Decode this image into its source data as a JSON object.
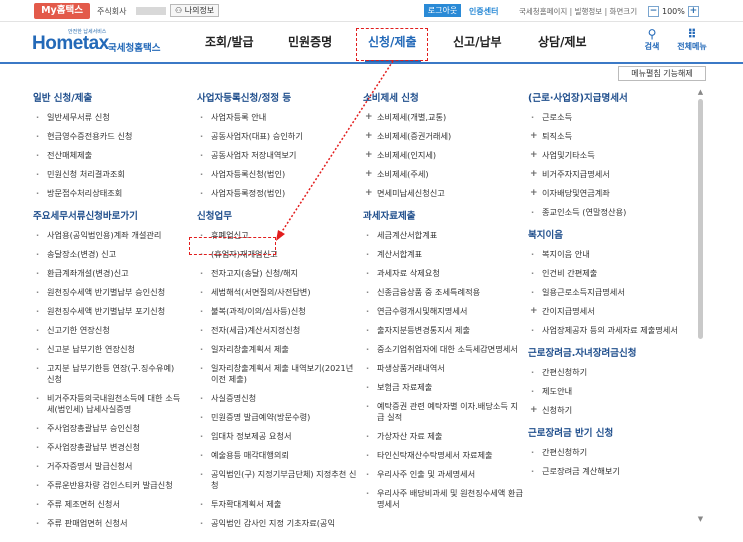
{
  "topbar": {
    "my_tab": "My홈택스",
    "company_label": "주식회사",
    "myinfo_label": "나의정보",
    "logout_label": "로그아웃",
    "cert_center_label": "인증센터",
    "links_text": "국세청홈페이지 | 빌행정보 | 화면크기",
    "zoom_minus": "−",
    "zoom_level": "100%",
    "zoom_plus": "+"
  },
  "header": {
    "logo_small": "안전한 납세서비스",
    "logo_main": "Hometax",
    "logo_sub": "국세청홈택스",
    "nav": [
      "조회/발급",
      "민원증명",
      "신청/제출",
      "신고/납부",
      "상담/제보"
    ],
    "active_nav": "신청/제출",
    "search_label": "검색",
    "allmenu_label": "전체메뉴",
    "search_icon": "search-icon",
    "allmenu_icon": "grid-icon"
  },
  "menu_toggle_label": "메뉴펼침 기능해제",
  "col1": {
    "title": "일반 신청/제출",
    "items": [
      "일반세무서류 신청",
      "현금영수증전용카드 신청",
      "전산매체제출",
      "민원신청 처리결과조회",
      "방문접수처리상태조회"
    ],
    "title2": "주요세무서류신청바로가기",
    "items2": [
      "사업용(공익법인용)계좌 개설관리",
      "송달장소(변경) 신고",
      "환급계좌개설(변경)신고",
      "원천징수세액 반기별납부 승인신청",
      "원천징수세액 반기별납부 포기신청",
      "신고기한 연장신청",
      "신고분 납부기한 연장신청",
      "고지분 납부기한등 연장(구.징수유예) 신청",
      "비거주자등의국내원천소득에 대한 소득세(법인세) 납세사실증명",
      "주사업장총괄납부 승인신청",
      "주사업장총괄납부 변경신청",
      "거주자증명서 발급신청서",
      "주류운반용차량 검인스티커 발급신청",
      "주류 제조면허 신청서",
      "주류 판매업면허 신청서"
    ]
  },
  "col2": {
    "title": "사업자등록신청/정정 등",
    "items": [
      "사업자등록 안내",
      "공동사업자(대표) 승인하기",
      "공동사업자 저장내역보기",
      "사업자등록신청(법인)",
      "사업자등록정정(법인)"
    ],
    "title2": "신청업무",
    "items2": [
      "휴폐업신고",
      "(휴업자)재개업신고",
      "전자고지(송달) 신청/해지",
      "세법해석(서면질의/사전답변)",
      "불복(과적/이의/심사등)신청",
      "전자(세금)계산서지정신청",
      "일자리창출계획서 제출",
      "일자리창출계획서 제출 내역보기(2021년 이전 제출)",
      "사실증명신청",
      "민원증명 발급예약(방문수령)",
      "임대차 정보제공 요청서",
      "예술용등 매각대행의뢰",
      "공익법인(구) 지정기부금단체) 지정추천 신청",
      "투자확대계획서 제출",
      "공익법인 감사인 지정 기초자료(공익"
    ]
  },
  "col3": {
    "title": "소비제세 신청",
    "items": [
      "소비제세(개별,교통)",
      "소비제세(증권거래세)",
      "소비제세(인지세)",
      "소비제세(주세)",
      "면세미납세신청신고"
    ],
    "title2": "과세자료제출",
    "items2": [
      "세금계산서합계표",
      "계산서합계표",
      "과세자료 삭제요청",
      "신종금융상품 중 조세특례적용",
      "연금수령개시및해지명세서",
      "출자지분등변경통지서 제출",
      "중소기업취업자에 대한 소득세감면명세서",
      "파생상품거래내역서",
      "보험금 자료제출",
      "예탁증권 관련 예탁자별 이자.배당소득 지급 실적",
      "가상자산 자료 제출",
      "타인신탁재산수탁명세서 자료제출",
      "우리사주 인출 및 과세명세서",
      "우리사주 배당비과세 및 원천징수세액 환급명세서"
    ]
  },
  "col4": {
    "title": "(근로·사업장)지급명세서",
    "items": [
      "근로소득",
      "퇴직소득",
      "사업및기타소득",
      "비거주자지급명세서",
      "이자배당및연금계좌",
      "종교인소득 (연말정산용)"
    ],
    "items_plus": [
      false,
      true,
      true,
      true,
      true,
      false
    ],
    "title2": "복지이음",
    "items2": [
      "복지이음 안내",
      "인건비 간편제출",
      "일용근로소득지급명세서",
      "간이지급명세서",
      "사업장제공자 등의 과세자료 제출명세서"
    ],
    "items2_plus": [
      false,
      false,
      false,
      true,
      false
    ],
    "title3": "근로장려금.자녀장려금신청",
    "items3": [
      "간편신청하기",
      "제도안내",
      "신청하기"
    ],
    "items3_plus": [
      false,
      false,
      true
    ],
    "title4": "근로장려금 반기 신청",
    "items4": [
      "간편신청하기",
      "근로장려금 계산해보기"
    ]
  },
  "colors": {
    "accent": "#2369b8",
    "highlight": "#e21d1d",
    "my_tab": "#e35a4a"
  }
}
